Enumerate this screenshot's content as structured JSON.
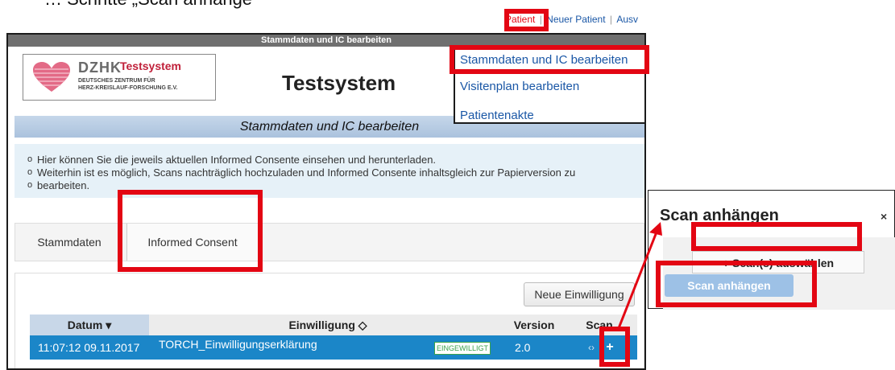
{
  "caption": "… Schritte „Scan anhänge",
  "top_nav": {
    "patient": "Patient",
    "separator": "|",
    "new_patient": "Neuer Patient",
    "truncated": "Ausv"
  },
  "window": {
    "title": "Stammdaten und IC bearbeiten",
    "app_title": "Testsystem",
    "logo": {
      "brand": "DZHK",
      "tag": "Testsystem",
      "line1": "DEUTSCHES ZENTRUM FÜR",
      "line2": "HERZ-KREISLAUF-FORSCHUNG E.V."
    },
    "section_header": "Stammdaten und IC bearbeiten",
    "info": [
      "Hier können Sie die jeweils aktuellen Informed Consente einsehen und herunterladen.",
      "Weiterhin ist es möglich, Scans nachträglich hochzuladen und Informed Consente inhaltsgleich zur Papierversion zu",
      "bearbeiten."
    ],
    "tabs": [
      "Stammdaten",
      "Informed Consent"
    ],
    "new_consent_button": "Neue Einwilligung",
    "table": {
      "headers": [
        "Datum ▾",
        "Einwilligung ◇",
        "Version",
        "Scan"
      ],
      "row": {
        "datum": "11:07:12 09.11.2017",
        "einwilligung": "TORCH_Einwilligungserklärung",
        "status": "EINGEWILLIGT",
        "version": "2.0",
        "scan_view_icon": "‹›",
        "scan_add_icon": "+"
      }
    }
  },
  "dropdown_menu": [
    "Stammdaten und IC bearbeiten",
    "Visitenplan bearbeiten",
    "Patientenakte"
  ],
  "dialog": {
    "title": "Scan anhängen",
    "close": "×",
    "select_button": "+ Scan(s) auswählen",
    "attach_button": "Scan anhängen"
  },
  "colors": {
    "highlight": "#e30613",
    "accent_blue": "#1b86c8",
    "link_blue": "#1a57a6"
  }
}
